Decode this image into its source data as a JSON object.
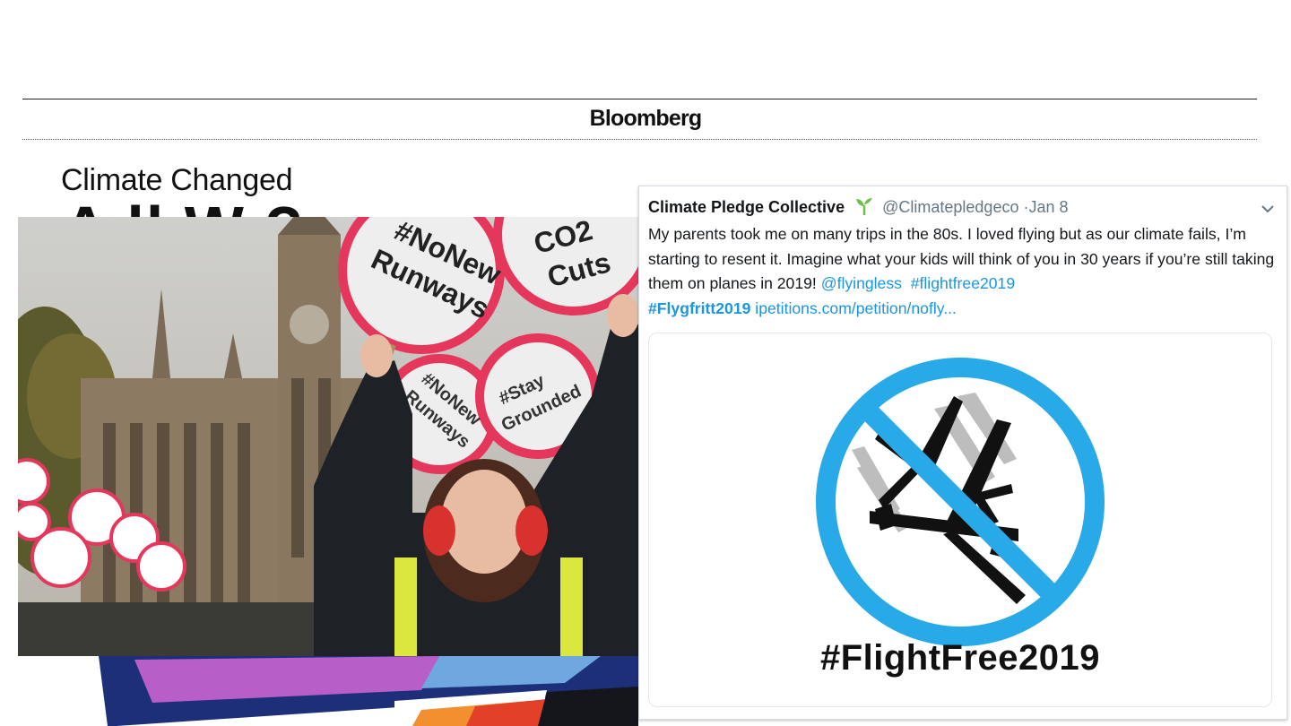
{
  "page": {
    "masthead": "Bloomberg",
    "section_title": "Climate Changed",
    "headline_fragment": "A ll    W     ?"
  },
  "photo": {
    "signs": [
      "#NoNew Runways",
      "CO2 Cuts",
      "#NoNew Runways",
      "#Stay Grounded"
    ],
    "colors": {
      "sign_rim": "#e5365c",
      "sign_face": "#f5f5f5"
    }
  },
  "tweet": {
    "author_name": "Climate Pledge Collective",
    "handle": "@Climatepledgeco",
    "date": "·Jan 8",
    "icon": "sprout-icon",
    "text_segments": {
      "main": "My parents took me on many trips in the 80s. I loved flying but as our climate fails, I’m starting to resent it. Imagine what your kids will think of you in 30 years if you’re still taking them on planes in 2019!",
      "mention": "@flyingless",
      "hashtag1": "#flightfree2019",
      "hashtag2": "#Flygfritt2019",
      "link": "ipetitions.com/petition/nofly..."
    },
    "card": {
      "caption": "#FlightFree2019",
      "icon": "no-flying-icon",
      "colors": {
        "ring": "#28a9e8",
        "plane": "#111111"
      }
    },
    "colors": {
      "link": "#1b95e0",
      "text": "#14171a",
      "muted": "#657786"
    }
  }
}
